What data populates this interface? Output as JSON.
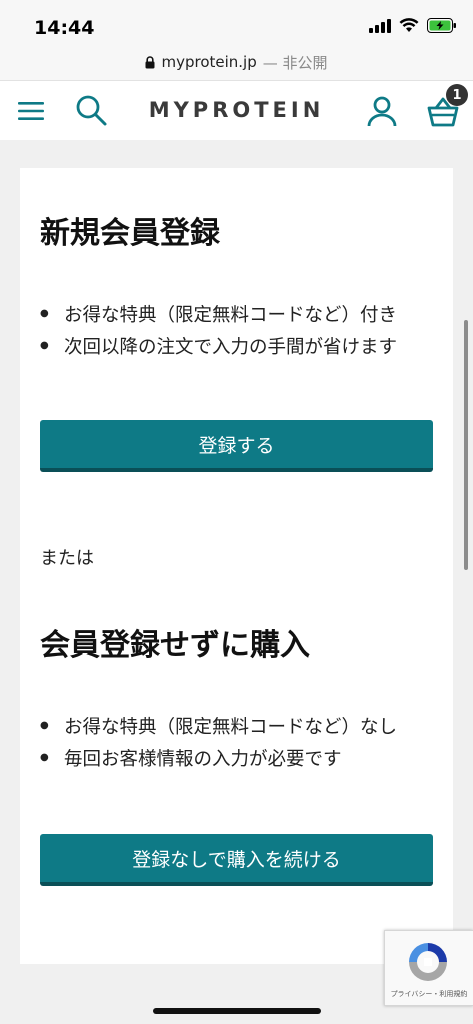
{
  "status_bar": {
    "time": "14:44"
  },
  "url_bar": {
    "domain": "myprotein.jp",
    "suffix": "— 非公開"
  },
  "header": {
    "logo": "MYPROTEIN",
    "basket_count": "1"
  },
  "register_section": {
    "title": "新規会員登録",
    "benefits": [
      "お得な特典（限定無料コードなど）付き",
      "次回以降の注文で入力の手間が省けます"
    ],
    "button_label": "登録する"
  },
  "or_text": "または",
  "guest_section": {
    "title": "会員登録せずに購入",
    "benefits": [
      "お得な特典（限定無料コードなど）なし",
      "毎回お客様情報の入力が必要です"
    ],
    "button_label": "登録なしで購入を続ける"
  },
  "recaptcha": {
    "text": "プライバシー・利用規約"
  },
  "colors": {
    "brand_teal": "#0e7a86",
    "button_shadow": "#0a4f57",
    "page_bg": "#f0f0f0"
  }
}
